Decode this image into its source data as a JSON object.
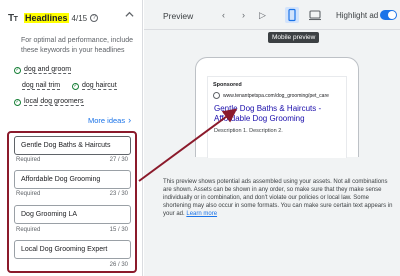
{
  "headlines": {
    "icon": "text-format-icon",
    "title": "Headlines",
    "count": "4/15",
    "tip": "For optimal ad performance, include these keywords in your headlines",
    "keywords": [
      {
        "label": "dog and groom",
        "status": "added"
      },
      {
        "label": "dog nail trim",
        "status": "not-added"
      },
      {
        "label": "dog haircut",
        "status": "added"
      },
      {
        "label": "local dog groomers",
        "status": "added"
      }
    ],
    "more_ideas": "More ideas",
    "fields": [
      {
        "value": "Gentle Dog Baths & Haircuts",
        "meta_left": "Required",
        "meta_right": "27 / 30"
      },
      {
        "value": "Affordable Dog Grooming",
        "meta_left": "Required",
        "meta_right": "23 / 30"
      },
      {
        "value": "Dog Grooming LA",
        "meta_left": "Required",
        "meta_right": "15 / 30"
      },
      {
        "value": "Local Dog Grooming Expert",
        "meta_left": "",
        "meta_right": "26 / 30"
      }
    ]
  },
  "preview": {
    "title": "Preview",
    "highlight_label": "Highlight ad",
    "highlight_on": true,
    "tooltip": "Mobile preview",
    "ad": {
      "sponsored": "Sponsored",
      "url": "www.tenantpetspa.com/dog_grooming/pet_care",
      "headline": "Gentle Dog Baths & Haircuts - Affordable Dog Grooming",
      "description": "Description 1. Description 2."
    },
    "info_text": "This preview shows potential ads assembled using your assets. Not all combinations are shown. Assets can be shown in any order, so make sure that they make sense individually or in combination, and don't violate our policies or local law. Some shortening may also occur in some formats. You can make sure certain text appears in your ad.",
    "learn_more": "Learn more"
  },
  "colors": {
    "accent": "#1a73e8",
    "highlight_box": "#8b1a2b",
    "check_green": "#188038",
    "keyword_highlight": "#ffff00"
  }
}
